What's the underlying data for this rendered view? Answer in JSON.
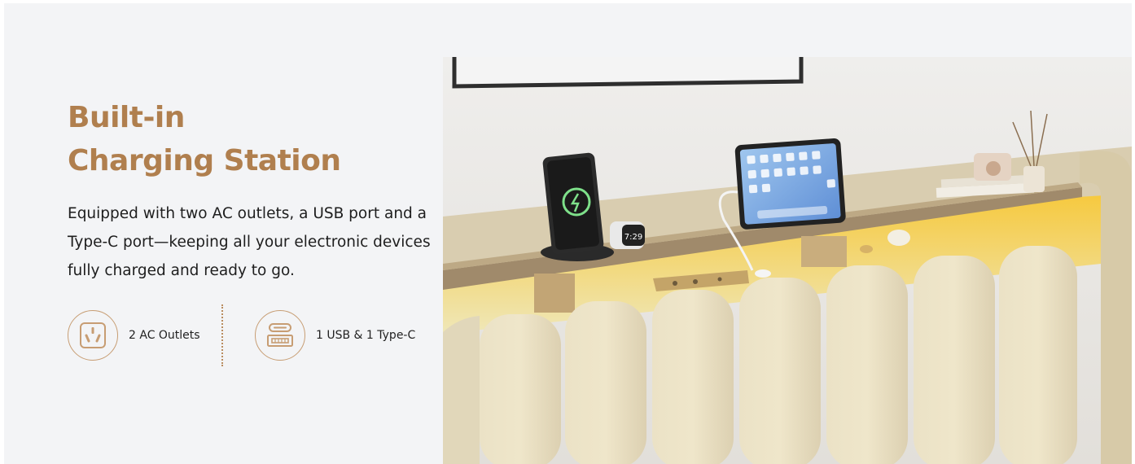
{
  "heading": {
    "line1": "Built-in",
    "line2": "Charging Station"
  },
  "description": "Equipped with two AC outlets, a USB port and a Type-C port—keeping all your electronic devices fully charged and ready to go.",
  "features": [
    {
      "label": "2 AC Outlets",
      "icon": "ac-outlet-icon"
    },
    {
      "label": "1 USB & 1 Type-C",
      "icon": "usb-port-icon"
    }
  ],
  "photo": {
    "phone_stand_time": "7:29"
  },
  "colors": {
    "accent": "#b07f4e",
    "icon_ring": "#c79d73",
    "background": "#f3f4f6",
    "text": "#1e1e1e"
  }
}
